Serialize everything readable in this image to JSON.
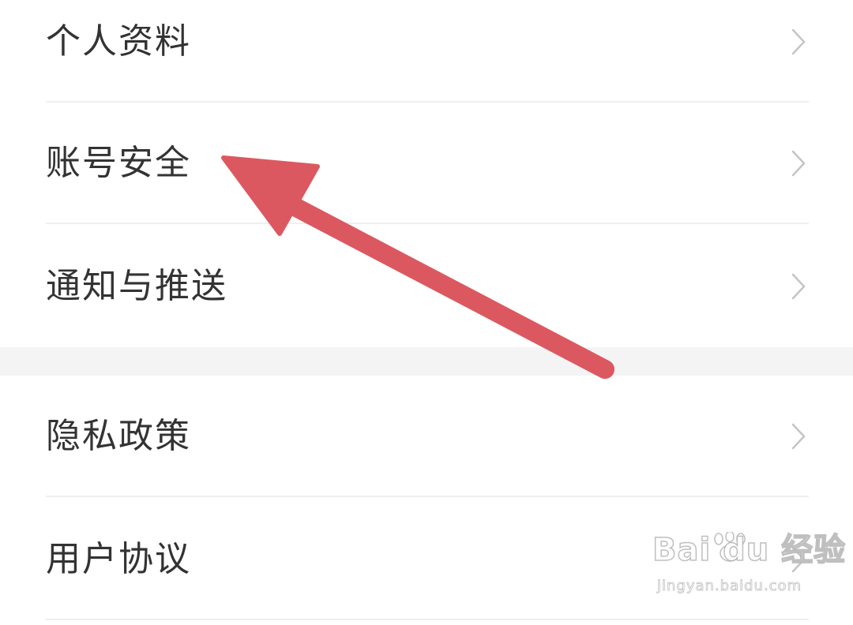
{
  "settings": {
    "group_1": [
      {
        "label": "个人资料",
        "icon": "chevron-right-icon"
      },
      {
        "label": "账号安全",
        "icon": "chevron-right-icon"
      },
      {
        "label": "通知与推送",
        "icon": "chevron-right-icon"
      }
    ],
    "group_2": [
      {
        "label": "隐私政策",
        "icon": "chevron-right-icon"
      },
      {
        "label": "用户协议",
        "icon": "chevron-right-icon"
      }
    ]
  },
  "annotation": {
    "type": "arrow",
    "color": "#dc5860",
    "points_to": "账号安全"
  },
  "watermark": {
    "logo": "Bai du 经验",
    "url": "jingyan.baidu.com"
  },
  "colors": {
    "text": "#333333",
    "chevron": "#c4c4c4",
    "divider": "#efefef",
    "group_gap": "#f4f4f4",
    "background": "#ffffff"
  }
}
